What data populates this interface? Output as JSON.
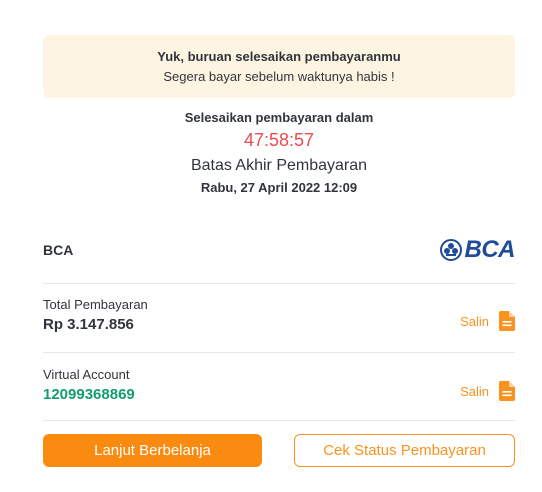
{
  "notice": {
    "title": "Yuk, buruan selesaikan pembayaranmu",
    "subtitle": "Segera bayar sebelum waktunya habis !"
  },
  "countdown": {
    "label": "Selesaikan pembayaran dalam",
    "timer": "47:58:57",
    "deadline_label": "Batas Akhir Pembayaran",
    "deadline": "Rabu, 27 April 2022 12:09"
  },
  "bank": {
    "name": "BCA",
    "logo_text": "BCA"
  },
  "total": {
    "label": "Total Pembayaran",
    "value": "Rp 3.147.856",
    "copy_label": "Salin"
  },
  "va": {
    "label": "Virtual Account",
    "value": "12099368869",
    "copy_label": "Salin"
  },
  "buttons": {
    "continue_label": "Lanjut Berbelanja",
    "status_label": "Cek Status Pembayaran"
  },
  "colors": {
    "accent": "#f7931e",
    "primary_button": "#fa8b10",
    "timer": "#ef4b4b",
    "va_value": "#139d6d",
    "notice_bg": "#fdf5e1",
    "bca_blue": "#1f4b99"
  },
  "icons": {
    "copy": "document-icon",
    "bank_emblem": "bca-emblem-icon"
  }
}
